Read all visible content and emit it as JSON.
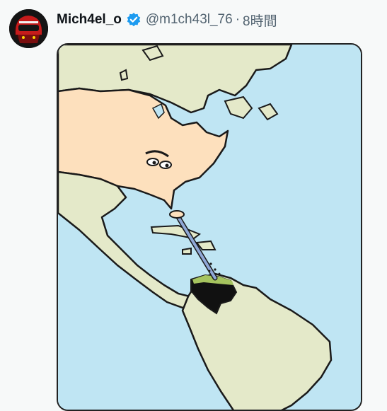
{
  "tweet": {
    "author": {
      "display_name": "Mich4el_o",
      "handle": "@m1ch43l_76",
      "verified": true,
      "avatar_icon": "helmet-avatar"
    },
    "separator": "·",
    "timestamp": "8時間",
    "media": {
      "type": "cartoon-image",
      "subject": "map of the Americas",
      "colors": {
        "ocean": "#bfe5f3",
        "land": "#e4e9c9",
        "usa": "#fde0bd",
        "venezuela": "#111111",
        "oil_ring": "#a6c45f",
        "straw": "#8fa7d6"
      }
    }
  },
  "colors": {
    "verified_badge": "#1d9bf0",
    "name_text": "#0f1419",
    "meta_text": "#536471",
    "background": "#f7f9f9"
  }
}
